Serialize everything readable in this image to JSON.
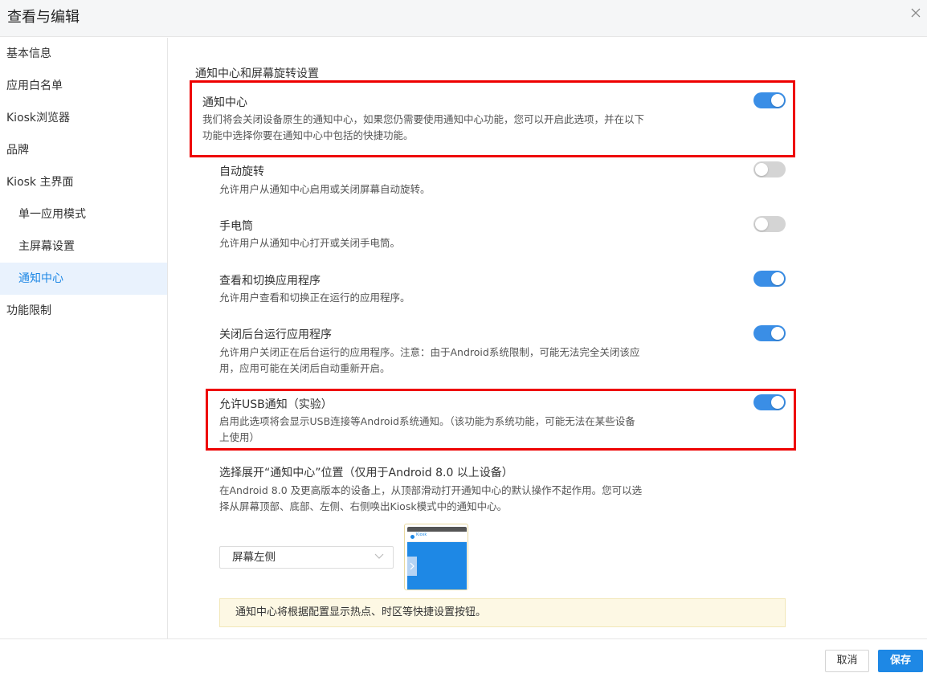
{
  "header": {
    "title": "查看与编辑"
  },
  "sidebar": {
    "items": [
      {
        "label": "基本信息"
      },
      {
        "label": "应用白名单"
      },
      {
        "label": "Kiosk浏览器"
      },
      {
        "label": "品牌"
      },
      {
        "label": "Kiosk 主界面"
      },
      {
        "label": "单一应用模式"
      },
      {
        "label": "主屏幕设置"
      },
      {
        "label": "通知中心"
      },
      {
        "label": "功能限制"
      }
    ],
    "active_item": "通知中心"
  },
  "main": {
    "section_title": "通知中心和屏幕旋转设置",
    "settings": [
      {
        "name": "通知中心",
        "desc": "我们将会关闭设备原生的通知中心，如果您仍需要使用通知中心功能，您可以开启此选项，并在以下功能中选择你要在通知中心中包括的快捷功能。",
        "enabled": true
      },
      {
        "name": "自动旋转",
        "desc": "允许用户从通知中心启用或关闭屏幕自动旋转。",
        "enabled": false
      },
      {
        "name": "手电筒",
        "desc": "允许用户从通知中心打开或关闭手电筒。",
        "enabled": false
      },
      {
        "name": "查看和切换应用程序",
        "desc": "允许用户查看和切换正在运行的应用程序。",
        "enabled": true
      },
      {
        "name": "关闭后台运行应用程序",
        "desc": "允许用户关闭正在后台运行的应用程序。注意：由于Android系统限制，可能无法完全关闭该应用，应用可能在关闭后自动重新开启。",
        "enabled": true
      },
      {
        "name": "允许USB通知（实验）",
        "desc": "启用此选项将会显示USB连接等Android系统通知。（该功能为系统功能，可能无法在某些设备上使用）",
        "enabled": true
      }
    ],
    "position": {
      "name": "选择展开“通知中心”位置（仅用于Android 8.0 以上设备）",
      "desc": "在Android 8.0 及更高版本的设备上，从顶部滑动打开通知中心的默认操作不起作用。您可以选择从屏幕顶部、底部、左侧、右侧唤出Kiosk模式中的通知中心。",
      "selected": "屏幕左侧",
      "preview_label": "Kiosk"
    },
    "tip": "通知中心将根据配置显示热点、时区等快捷设置按钮。"
  },
  "footer": {
    "cancel_label": "取消",
    "save_label": "保存"
  },
  "colors": {
    "accent": "#1e88e5",
    "toggle_on": "#3a8ee6",
    "toggle_off": "#d4d4d4",
    "highlight_box": "#e00000",
    "active_nav_bg": "#e9f2fd",
    "tip_bg": "#fdf8e4"
  },
  "icons": {
    "close": "close-icon",
    "dropdown": "chevron-down-icon",
    "preview_handle": "chevron-right-icon"
  }
}
